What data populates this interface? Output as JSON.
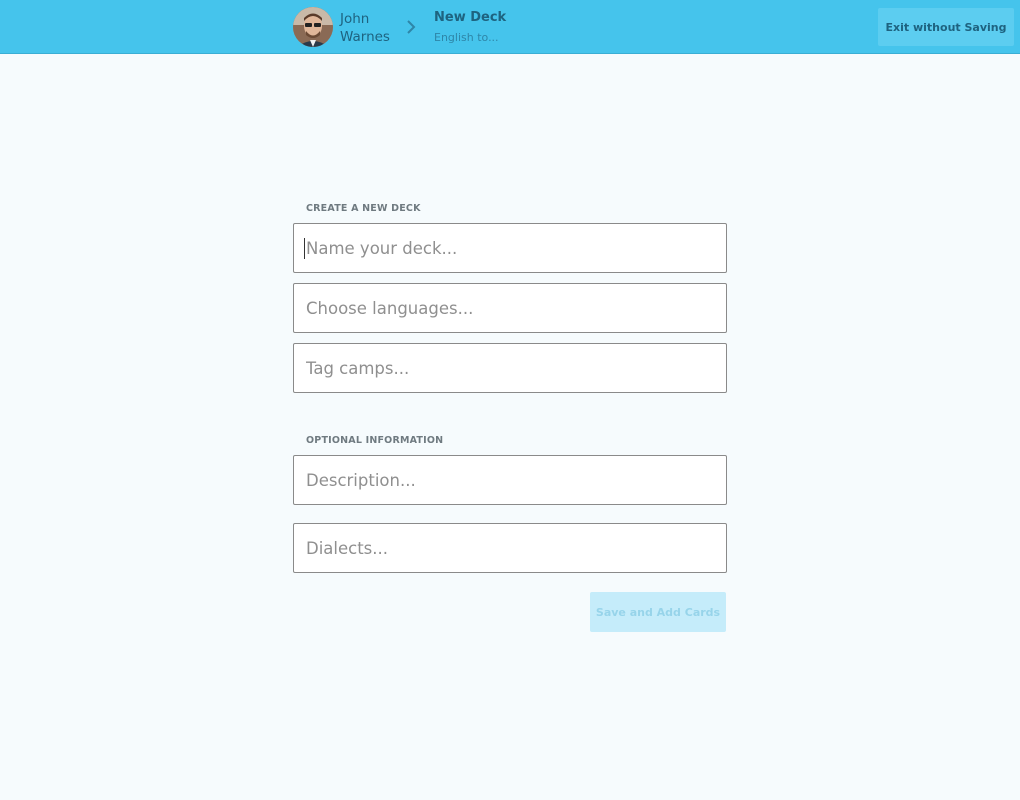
{
  "header": {
    "user_first_name": "John",
    "user_last_name": "Warnes",
    "breadcrumb_title": "New Deck",
    "breadcrumb_subtitle": "English to...",
    "exit_label": "Exit without Saving"
  },
  "form": {
    "create_section_label": "CREATE A NEW DECK",
    "name_placeholder": "Name your deck...",
    "languages_placeholder": "Choose languages...",
    "tags_placeholder": "Tag camps...",
    "optional_section_label": "OPTIONAL INFORMATION",
    "description_placeholder": "Description...",
    "dialects_placeholder": "Dialects...",
    "submit_label": "Save and Add Cards"
  },
  "colors": {
    "header_bg": "#45c4ec",
    "page_bg": "#f6fbfd",
    "submit_disabled_bg": "#c5ecfa"
  }
}
